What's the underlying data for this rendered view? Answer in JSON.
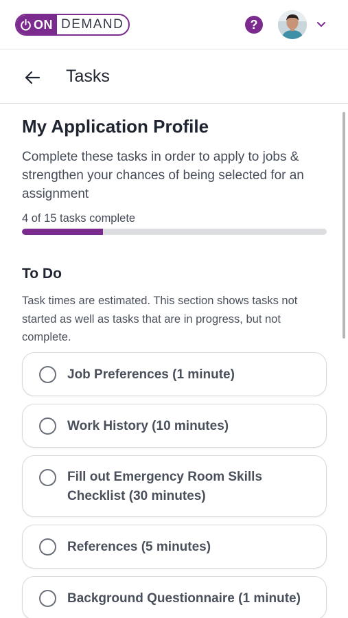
{
  "header": {
    "logo_on": "ON",
    "logo_demand": "DEMAND",
    "help_label": "?",
    "accent_color": "#7b2a8e"
  },
  "subheader": {
    "title": "Tasks"
  },
  "profile": {
    "title": "My Application Profile",
    "intro": "Complete these tasks in order to apply to jobs & strengthen your chances of being selected for an assignment",
    "progress_text": "4 of 15 tasks complete",
    "progress_fraction": 0.2667
  },
  "todo": {
    "title": "To Do",
    "note": "Task times are estimated. This section shows tasks not started as well as tasks that are in progress, but not complete.",
    "tasks": [
      {
        "label": "Job Preferences (1 minute)"
      },
      {
        "label": "Work History (10 minutes)"
      },
      {
        "label": "Fill out Emergency Room Skills Checklist (30 minutes)"
      },
      {
        "label": "References (5 minutes)"
      },
      {
        "label": "Background Questionnaire (1 minute)"
      }
    ]
  }
}
